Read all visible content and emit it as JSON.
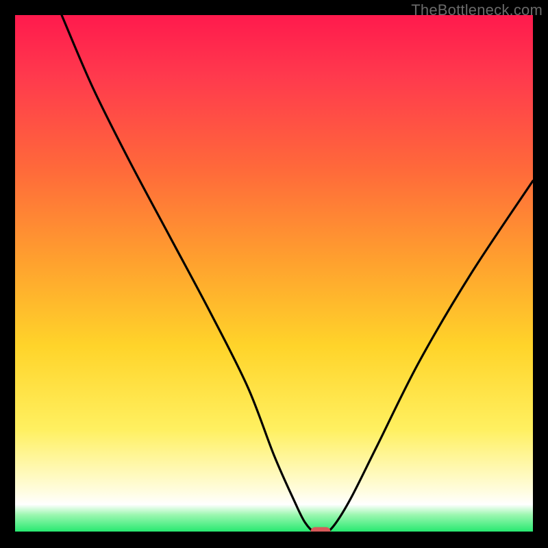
{
  "watermark": "TheBottleneck.com",
  "chart_data": {
    "type": "line",
    "title": "",
    "xlabel": "",
    "ylabel": "",
    "xlim": [
      0,
      100
    ],
    "ylim": [
      0,
      100
    ],
    "grid": false,
    "legend": false,
    "background_gradient_stops": [
      {
        "pos": 0,
        "color": "#ff1a4d"
      },
      {
        "pos": 12,
        "color": "#ff3a4d"
      },
      {
        "pos": 30,
        "color": "#ff6a3a"
      },
      {
        "pos": 48,
        "color": "#ffa22e"
      },
      {
        "pos": 64,
        "color": "#ffd42a"
      },
      {
        "pos": 80,
        "color": "#fff060"
      },
      {
        "pos": 92,
        "color": "#fffde0"
      },
      {
        "pos": 94.5,
        "color": "#ffffff"
      },
      {
        "pos": 96.5,
        "color": "#9cf7b0"
      },
      {
        "pos": 100,
        "color": "#1ee86b"
      }
    ],
    "series": [
      {
        "name": "bottleneck-curve",
        "color": "#000000",
        "x": [
          9,
          15,
          22,
          30,
          38,
          45,
          50,
          54,
          56,
          58,
          60,
          62,
          65,
          70,
          78,
          88,
          100
        ],
        "y": [
          100,
          86,
          72,
          57,
          42,
          28,
          15,
          6,
          2,
          0,
          0,
          2,
          7,
          17,
          33,
          50,
          68
        ]
      }
    ],
    "marker": {
      "name": "optimal-point-marker",
      "x": 59,
      "y": 0,
      "color": "#d85a5a",
      "shape": "rounded-rect"
    }
  }
}
